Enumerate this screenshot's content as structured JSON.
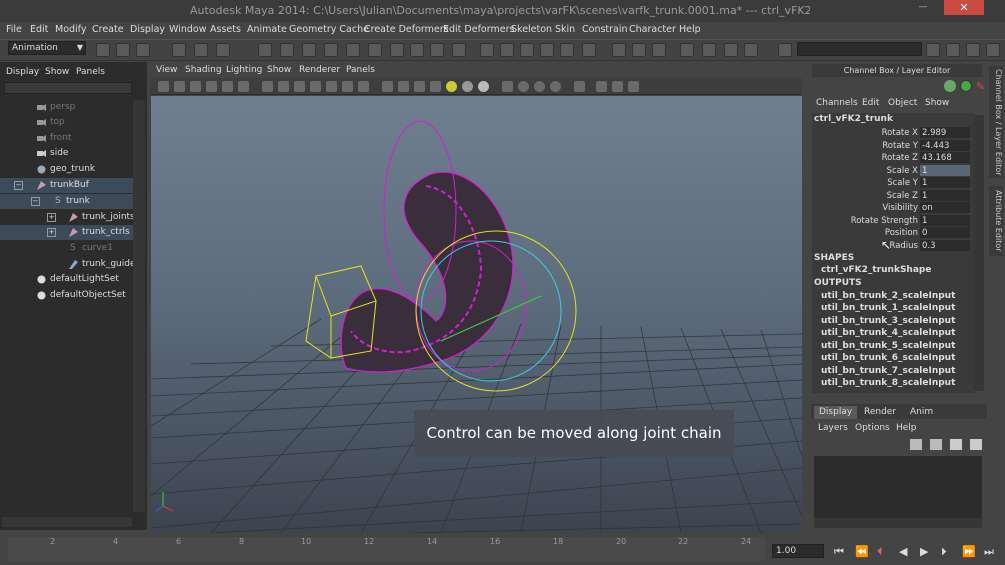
{
  "window": {
    "title": "Autodesk Maya 2014: C:\\Users\\Julian\\Documents\\maya\\projects\\varFK\\scenes\\varfk_trunk.0001.ma*  ---  ctrl_vFK2_trunk"
  },
  "menubar": [
    "File",
    "Edit",
    "Modify",
    "Create",
    "Display",
    "Window",
    "Assets",
    "Animate",
    "Geometry Cache",
    "Create Deformers",
    "Edit Deformers",
    "Skeleton",
    "Skin",
    "Constrain",
    "Character",
    "Help"
  ],
  "shelf": {
    "mode": "Animation"
  },
  "outliner": {
    "menu": [
      "Display",
      "Show",
      "Panels"
    ],
    "items": [
      {
        "label": "persp",
        "dim": true
      },
      {
        "label": "top",
        "dim": true
      },
      {
        "label": "front",
        "dim": true
      },
      {
        "label": "side",
        "dim": false
      },
      {
        "label": "geo_trunk",
        "dim": false
      },
      {
        "label": "trunkBuf",
        "dim": false,
        "sel": true
      },
      {
        "label": "trunk",
        "dim": false,
        "sel": true
      },
      {
        "label": "trunk_joints",
        "dim": false
      },
      {
        "label": "trunk_ctrls",
        "dim": false,
        "sel": true
      },
      {
        "label": "curve1",
        "dim": true
      },
      {
        "label": "trunk_guide_",
        "dim": false
      },
      {
        "label": "defaultLightSet",
        "dim": false
      },
      {
        "label": "defaultObjectSet",
        "dim": false
      }
    ]
  },
  "viewport": {
    "menu": [
      "View",
      "Shading",
      "Lighting",
      "Show",
      "Renderer",
      "Panels"
    ],
    "caption": "Control can be moved along joint chain"
  },
  "channel_box": {
    "header": "Channel Box / Layer Editor",
    "menu": [
      "Channels",
      "Edit",
      "Object",
      "Show"
    ],
    "object": "ctrl_vFK2_trunk",
    "attributes": [
      {
        "label": "Rotate X",
        "value": "2.989"
      },
      {
        "label": "Rotate Y",
        "value": "-4.443"
      },
      {
        "label": "Rotate Z",
        "value": "43.168"
      },
      {
        "label": "Scale X",
        "value": "1",
        "hl": true
      },
      {
        "label": "Scale Y",
        "value": "1"
      },
      {
        "label": "Scale Z",
        "value": "1"
      },
      {
        "label": "Visibility",
        "value": "on"
      },
      {
        "label": "Rotate Strength",
        "value": "1"
      },
      {
        "label": "Position",
        "value": "0"
      },
      {
        "label": "Radius",
        "value": "0.3"
      }
    ],
    "shapes_label": "SHAPES",
    "shape": "ctrl_vFK2_trunkShape",
    "outputs_label": "OUTPUTS",
    "outputs": [
      "util_bn_trunk_2_scaleInput",
      "util_bn_trunk_1_scaleInput",
      "util_bn_trunk_3_scaleInput",
      "util_bn_trunk_4_scaleInput",
      "util_bn_trunk_5_scaleInput",
      "util_bn_trunk_6_scaleInput",
      "util_bn_trunk_7_scaleInput",
      "util_bn_trunk_8_scaleInput"
    ],
    "side_tabs": [
      "Channel Box / Layer Editor",
      "Attribute Editor"
    ]
  },
  "layers": {
    "tabs": [
      "Display",
      "Render",
      "Anim"
    ],
    "menu": [
      "Layers",
      "Options",
      "Help"
    ]
  },
  "timeline": {
    "ticks": [
      "2",
      "4",
      "6",
      "8",
      "10",
      "12",
      "14",
      "16",
      "18",
      "20",
      "22",
      "24"
    ],
    "current_time": "1.00"
  },
  "colors": {
    "accent_select": "#3d4a5a",
    "control_magenta": "#d020d0",
    "control_yellow": "#e8e020",
    "control_cyan": "#40c8e0"
  }
}
